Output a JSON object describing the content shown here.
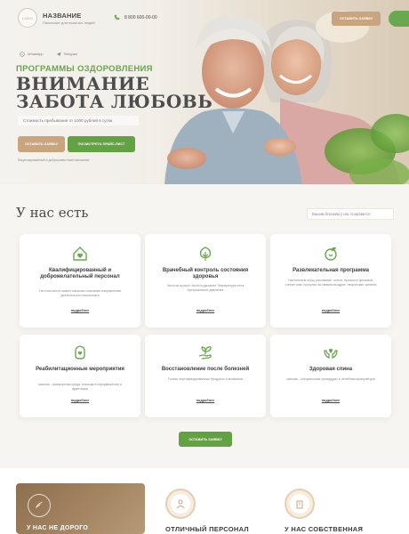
{
  "header": {
    "logo_badge": "LOGO",
    "brand_name": "НАЗВАНИЕ",
    "brand_tagline": "Пансионат для пожилых людей",
    "phone": "8 800 600-00-00",
    "cta_label": "ОСТАВИТЬ ЗАЯВКУ"
  },
  "hero": {
    "socials": [
      {
        "label": "WhatsApp",
        "icon": "whatsapp-icon"
      },
      {
        "label": "Telegram",
        "icon": "telegram-icon"
      }
    ],
    "program_title": "ПРОГРАММЫ ОЗДОРОВЛЕНИЯ",
    "headline_line1": "ВНИМАНИЕ",
    "headline_line2": "ЗАБОТА ЛЮБОВЬ",
    "price_note": "Стоимость пребывания от 1000 рублей в сутки",
    "btn_request": "ОСТАВИТЬ ЗАЯВКУ",
    "btn_pricelist": "ПОСМОТРЕТЬ ПРАЙС-ЛИСТ",
    "license_note": "Лицензированный и добросовестный пансионат"
  },
  "services": {
    "title": "У нас есть",
    "search_placeholder": "Вашим близким у нас понравится",
    "more_label": "подробнее",
    "cards": [
      {
        "icon": "house-heart-icon",
        "title": "Квалифицированный и доброжелательный персонал",
        "desc": "На этом месте можно написать описание направления деятельности пансионата"
      },
      {
        "icon": "medical-tree-icon",
        "title": "Врачебный контроль состояния здоровья",
        "desc": "Частота пульса Частота дыхания Температура тела Артериальное давление"
      },
      {
        "icon": "leaf-drop-icon",
        "title": "Развлекательная программа",
        "desc": "Настольные игры, рисование, лепка, просмотр фильмов, чтение книг, прогулки на свежем воздухе, творческие занятия"
      },
      {
        "icon": "hand-heart-icon",
        "title": "Реабилитационные мероприятия",
        "desc": "массаж - комфортная среда, помощь в передвижении и адаптации"
      },
      {
        "icon": "sprout-hand-icon",
        "title": "Восстановление после болезней",
        "desc": "Только сертифицированные продукты и витамины"
      },
      {
        "icon": "hands-care-icon",
        "title": "Здоровая спина",
        "desc": "массаж - специальные процедуры и лечебная физкультура"
      }
    ],
    "center_button": "ОСТАВИТЬ ЗАЯВКУ"
  },
  "features": {
    "card_text": "У НАС НЕ ДОРОГО",
    "items": [
      {
        "icon": "staff-icon",
        "label": "ОТЛИЧНЫЙ ПЕРСОНАЛ"
      },
      {
        "icon": "building-icon",
        "label": "У НАС СОБСТВЕННАЯ"
      }
    ]
  },
  "colors": {
    "accent_green": "#62a243",
    "accent_tan": "#c9a57f",
    "title_green": "#6ea24f"
  }
}
